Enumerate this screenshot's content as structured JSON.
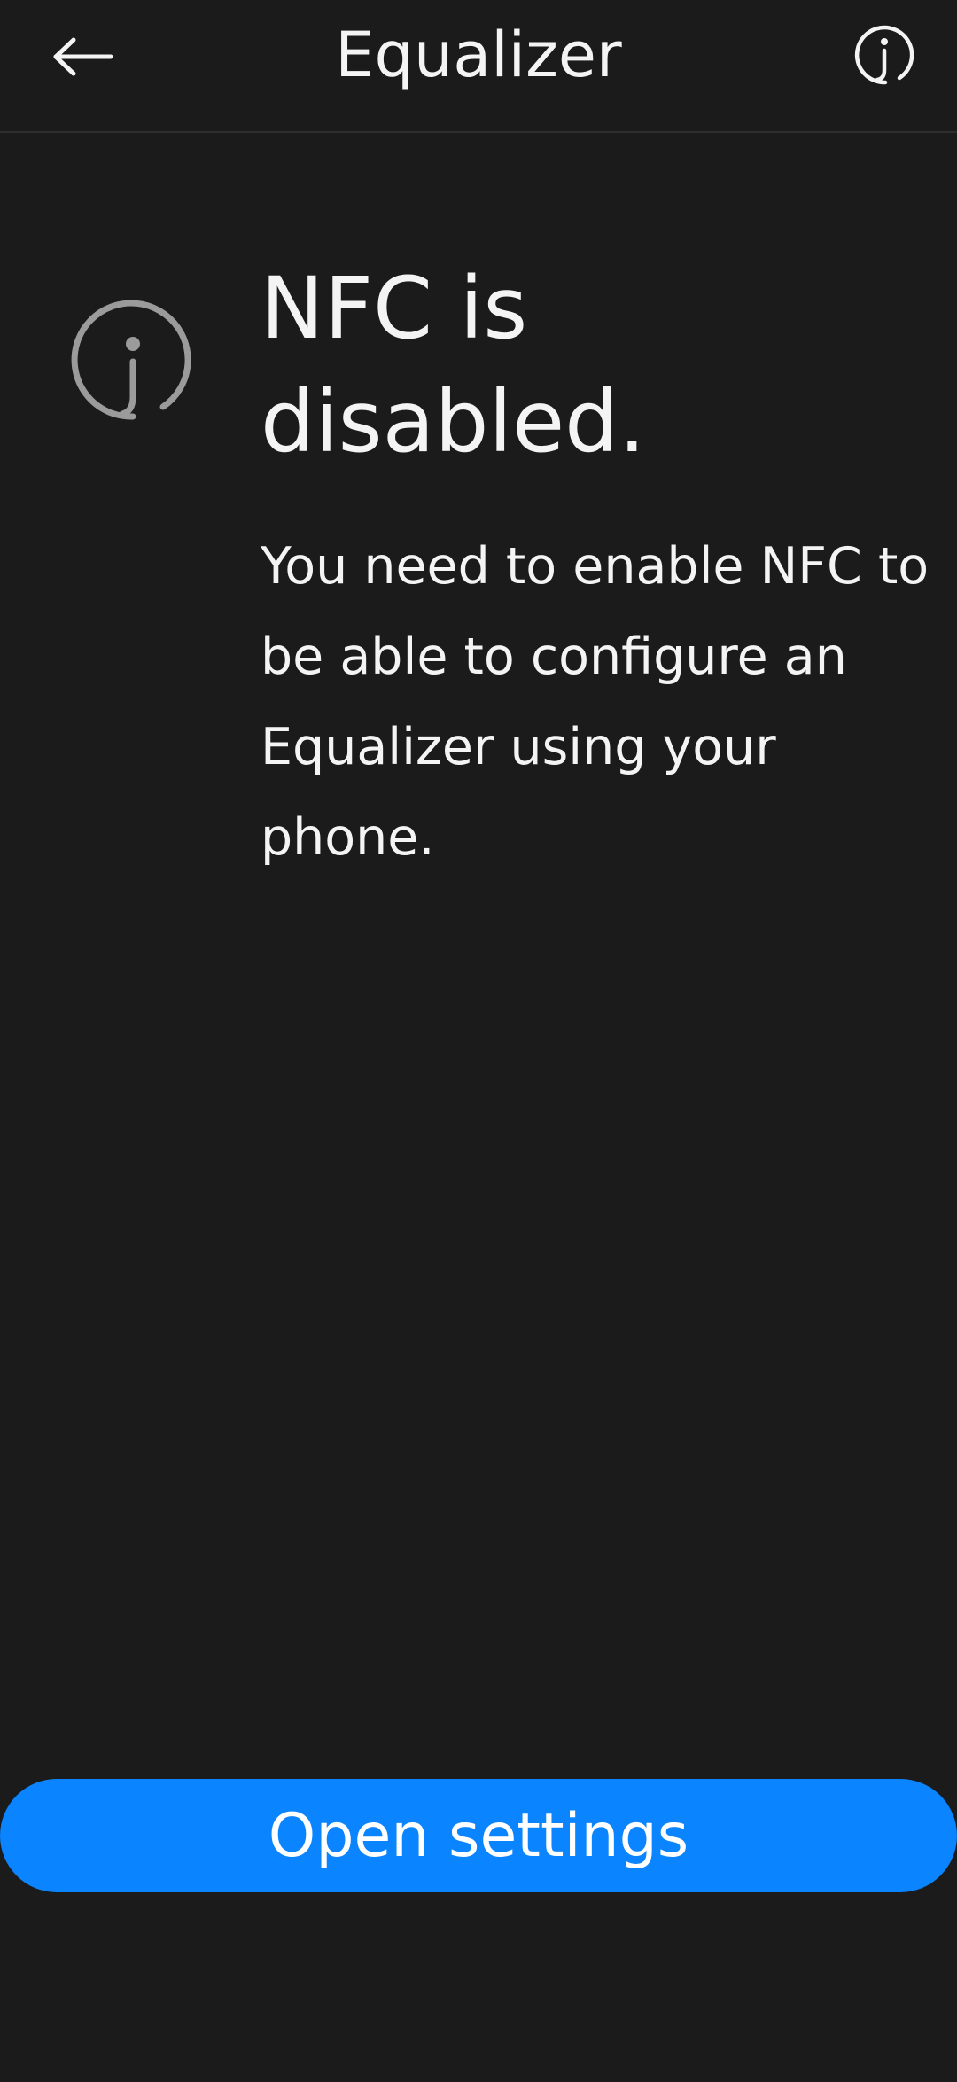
{
  "header": {
    "title": "Equalizer",
    "back_icon": "back-arrow-icon",
    "info_icon": "info-icon"
  },
  "message": {
    "icon": "info-circle-icon",
    "title": "NFC is disabled.",
    "body": "You need to enable NFC to be able to configure an Equalizer using your phone."
  },
  "actions": {
    "open_settings_label": "Open settings"
  },
  "colors": {
    "background": "#1b1b1b",
    "text": "#f4f4f4",
    "accent": "#0a84ff",
    "icon_gray": "#9b9b9b"
  }
}
